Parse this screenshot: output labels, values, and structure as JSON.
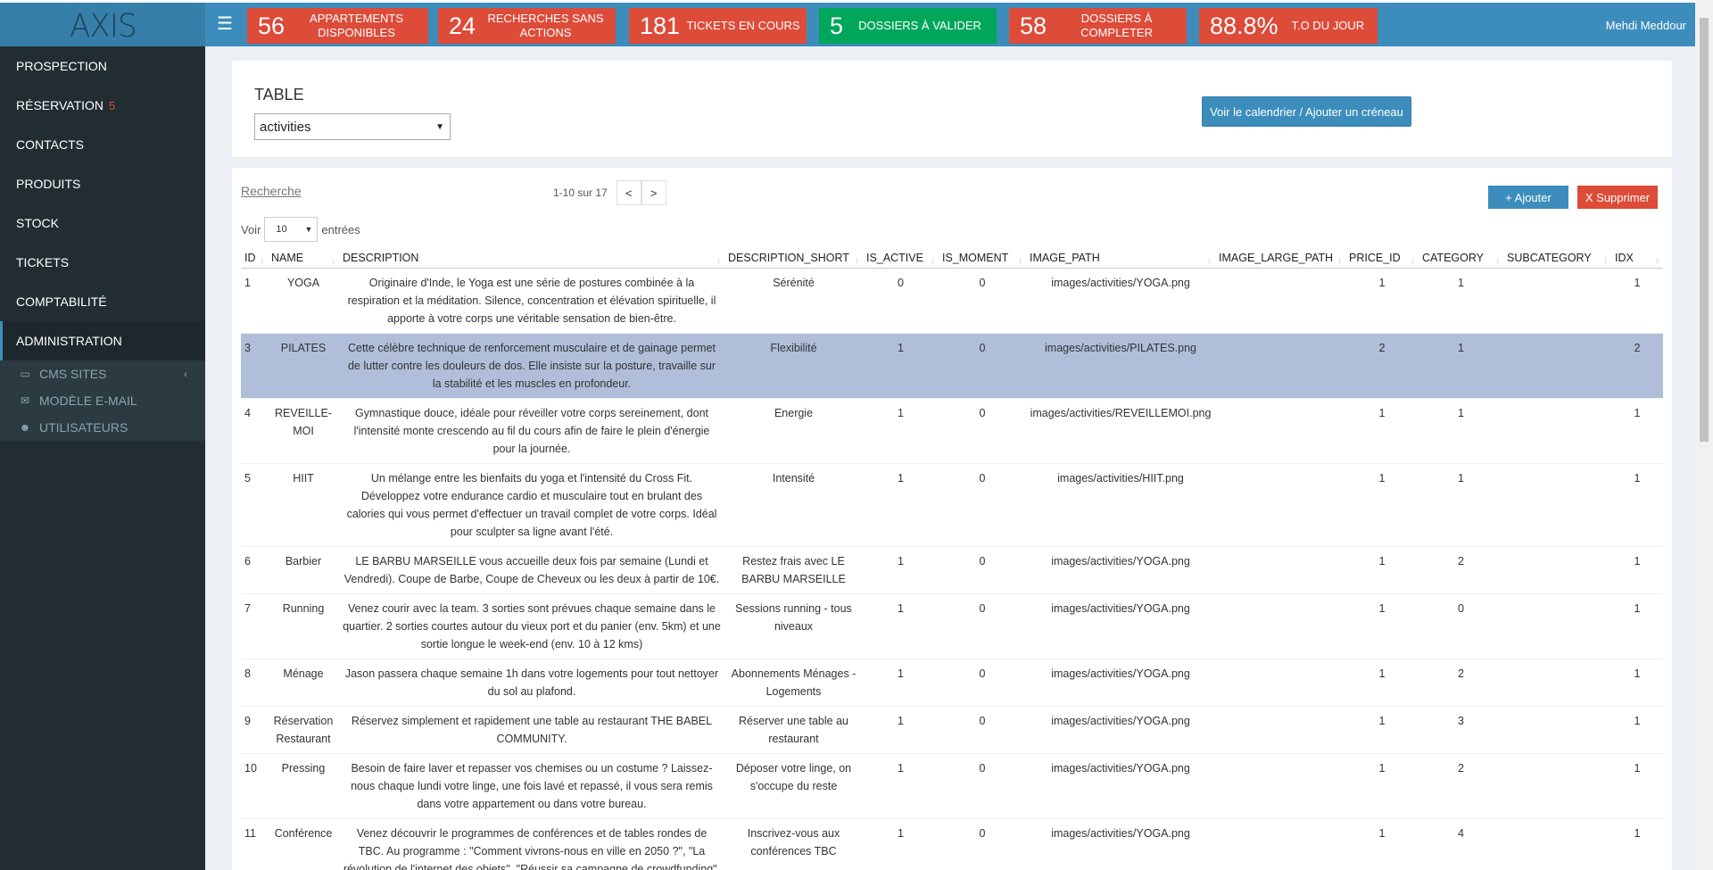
{
  "header": {
    "logo": "AXIS",
    "user": "Mehdi Meddour",
    "stats": [
      {
        "num": "56",
        "label": "APPARTEMENTS DISPONIBLES",
        "color": "#dd4b39"
      },
      {
        "num": "24",
        "label": "RECHERCHES SANS ACTIONS",
        "color": "#dd4b39"
      },
      {
        "num": "181",
        "label": "TICKETS EN COURS",
        "color": "#dd4b39"
      },
      {
        "num": "5",
        "label": "DOSSIERS À VALIDER",
        "color": "#00a65a"
      },
      {
        "num": "58",
        "label": "DOSSIERS À COMPLETER",
        "color": "#dd4b39"
      },
      {
        "num": "88.8%",
        "label": "T.O DU JOUR",
        "color": "#dd4b39"
      }
    ]
  },
  "sidebar": {
    "items": [
      {
        "label": "PROSPECTION"
      },
      {
        "label": "RÉSERVATION",
        "badge": "5"
      },
      {
        "label": "CONTACTS"
      },
      {
        "label": "PRODUITS"
      },
      {
        "label": "STOCK"
      },
      {
        "label": "TICKETS"
      },
      {
        "label": "COMPTABILITÉ"
      },
      {
        "label": "ADMINISTRATION"
      }
    ],
    "subitems": [
      {
        "label": "CMS SITES",
        "icon": "monitor-icon"
      },
      {
        "label": "MODÈLE E-MAIL",
        "icon": "envelope-icon"
      },
      {
        "label": "UTILISATEURS",
        "icon": "users-icon"
      }
    ]
  },
  "panel": {
    "title": "TABLE",
    "select_value": "activities",
    "calendar_button": "Voir le calendrier / Ajouter un créneau"
  },
  "table_tools": {
    "search": "Recherche",
    "page_info": "1-10 sur 17",
    "prev": "<",
    "next": ">",
    "add": "+ Ajouter",
    "delete": "X Supprimer",
    "show": "Voir",
    "length": "10",
    "entries": "entrées"
  },
  "columns": [
    "ID",
    "NAME",
    "DESCRIPTION",
    "DESCRIPTION_SHORT",
    "IS_ACTIVE",
    "IS_MOMENT",
    "IMAGE_PATH",
    "IMAGE_LARGE_PATH",
    "PRICE_ID",
    "CATEGORY",
    "SUBCATEGORY",
    "IDX"
  ],
  "rows": [
    [
      "1",
      "YOGA",
      "Originaire d'Inde, le Yoga est une série de postures combinée à la respiration et la méditation. Silence, concentration et élévation spirituelle, il apporte à votre corps une véritable sensation de bien-être.",
      "Sérénité",
      "0",
      "0",
      "images/activities/YOGA.png",
      "",
      "1",
      "1",
      "",
      "1"
    ],
    [
      "3",
      "PILATES",
      "Cette célèbre technique de renforcement musculaire et de gainage permet de lutter contre les douleurs de dos. Elle insiste sur la posture, travaille sur la stabilité et les muscles en profondeur.",
      "Flexibilité",
      "1",
      "0",
      "images/activities/PILATES.png",
      "",
      "2",
      "1",
      "",
      "2"
    ],
    [
      "4",
      "REVEILLE-MOI",
      "Gymnastique douce, idéale pour réveiller votre corps sereinement, dont l'intensité monte crescendo au fil du cours afin de faire le plein d'énergie pour la journée.",
      "Energie",
      "1",
      "0",
      "images/activities/REVEILLEMOI.png",
      "",
      "1",
      "1",
      "",
      "1"
    ],
    [
      "5",
      "HIIT",
      "Un mélange entre les bienfaits du yoga et l'intensité du Cross Fit. Développez votre endurance cardio et musculaire tout en brulant des calories qui vous permet d'effectuer un travail complet de votre corps. Idéal pour sculpter sa ligne avant l'été.",
      "Intensité",
      "1",
      "0",
      "images/activities/HIIT.png",
      "",
      "1",
      "1",
      "",
      "1"
    ],
    [
      "6",
      "Barbier",
      "LE BARBU MARSEILLE vous accueille deux fois par semaine (Lundi et Vendredi). Coupe de Barbe, Coupe de Cheveux ou les deux à partir de 10€.",
      "Restez frais avec LE BARBU MARSEILLE",
      "1",
      "0",
      "images/activities/YOGA.png",
      "",
      "1",
      "2",
      "",
      "1"
    ],
    [
      "7",
      "Running",
      "Venez courir avec la team. 3 sorties sont prévues chaque semaine dans le quartier. 2 sorties courtes autour du vieux port et du panier (env. 5km) et une sortie longue le week-end (env. 10 à 12 kms)",
      "Sessions running - tous niveaux",
      "1",
      "0",
      "images/activities/YOGA.png",
      "",
      "1",
      "0",
      "",
      "1"
    ],
    [
      "8",
      "Ménage",
      "Jason passera chaque semaine 1h dans votre logements pour tout nettoyer du sol au plafond.",
      "Abonnements Ménages - Logements",
      "1",
      "0",
      "images/activities/YOGA.png",
      "",
      "1",
      "2",
      "",
      "1"
    ],
    [
      "9",
      "Réservation Restaurant",
      "Réservez simplement et rapidement une table au restaurant THE BABEL COMMUNITY.",
      "Réserver une table au restaurant",
      "1",
      "0",
      "images/activities/YOGA.png",
      "",
      "1",
      "3",
      "",
      "1"
    ],
    [
      "10",
      "Pressing",
      "Besoin de faire laver et repasser vos chemises ou un costume ? Laissez-nous chaque lundi votre linge, une fois lavé et repassé, il vous sera remis dans votre appartement ou dans votre bureau.",
      "Déposer votre linge, on s'occupe du reste",
      "1",
      "0",
      "images/activities/YOGA.png",
      "",
      "1",
      "2",
      "",
      "1"
    ],
    [
      "11",
      "Conférence",
      "Venez découvrir le programmes de conférences et de tables rondes de TBC. Au programme : \"Comment vivrons-nous en ville en 2050 ?\", \"La révolution de l'internet des objets\", \"Réussir sa campagne de crowdfunding\", \"communiquer efficacement sur les réseaux sociaux\" etc...",
      "Inscrivez-vous aux conférences TBC",
      "1",
      "0",
      "images/activities/YOGA.png",
      "",
      "1",
      "4",
      "",
      "1"
    ]
  ],
  "selected_row_index": 1
}
